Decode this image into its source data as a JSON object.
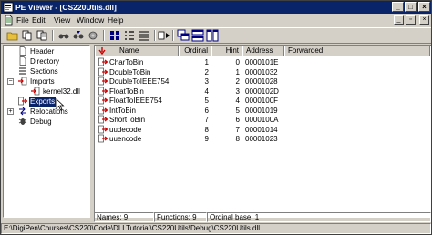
{
  "window": {
    "title": "PE Viewer - [CS220Utils.dll]",
    "minimize": "_",
    "maximize": "□",
    "close": "×"
  },
  "menu": [
    "File",
    "Edit",
    "View",
    "Window",
    "Help"
  ],
  "mdi_buttons": {
    "minimize": "_",
    "restore": "▫",
    "close": "×"
  },
  "tree": {
    "items": [
      {
        "label": "Header",
        "icon": "document-icon"
      },
      {
        "label": "Directory",
        "icon": "document-icon"
      },
      {
        "label": "Sections",
        "icon": "sections-icon"
      },
      {
        "label": "Imports",
        "icon": "arrow-in-icon",
        "expander": "−"
      },
      {
        "label": "kernel32.dll",
        "icon": "arrow-in-icon"
      },
      {
        "label": "Exports",
        "icon": "arrow-out-icon",
        "selected": true
      },
      {
        "label": "Relocations",
        "icon": "relocations-icon",
        "expander": "+"
      },
      {
        "label": "Debug",
        "icon": "bug-icon"
      }
    ]
  },
  "list": {
    "columns": [
      "Name",
      "Ordinal",
      "Hint",
      "Address",
      "Forwarded"
    ],
    "rows": [
      {
        "name": "CharToBin",
        "ordinal": "1",
        "hint": "0",
        "address": "0000101E",
        "forwarded": ""
      },
      {
        "name": "DoubleToBin",
        "ordinal": "2",
        "hint": "1",
        "address": "00001032",
        "forwarded": ""
      },
      {
        "name": "DoubleToIEEE754",
        "ordinal": "3",
        "hint": "2",
        "address": "00001028",
        "forwarded": ""
      },
      {
        "name": "FloatToBin",
        "ordinal": "4",
        "hint": "3",
        "address": "0000102D",
        "forwarded": ""
      },
      {
        "name": "FloatToIEEE754",
        "ordinal": "5",
        "hint": "4",
        "address": "0000100F",
        "forwarded": ""
      },
      {
        "name": "IntToBin",
        "ordinal": "6",
        "hint": "5",
        "address": "00001019",
        "forwarded": ""
      },
      {
        "name": "ShortToBin",
        "ordinal": "7",
        "hint": "6",
        "address": "0000100A",
        "forwarded": ""
      },
      {
        "name": "uudecode",
        "ordinal": "8",
        "hint": "7",
        "address": "00001014",
        "forwarded": ""
      },
      {
        "name": "uuencode",
        "ordinal": "9",
        "hint": "8",
        "address": "00001023",
        "forwarded": ""
      }
    ]
  },
  "status": {
    "names": "Names: 9",
    "functions": "Functions: 9",
    "ordinal_base": "Ordinal base: 1"
  },
  "path": "E:\\DigiPen\\Courses\\CS220\\Code\\DLLTutorial\\CS220Utils\\Debug\\CS220Utils.dll",
  "colors": {
    "title_bar": "#0a246a",
    "face": "#d4d0c8",
    "selection": "#0a246a",
    "export_icon": "#cc0000"
  }
}
